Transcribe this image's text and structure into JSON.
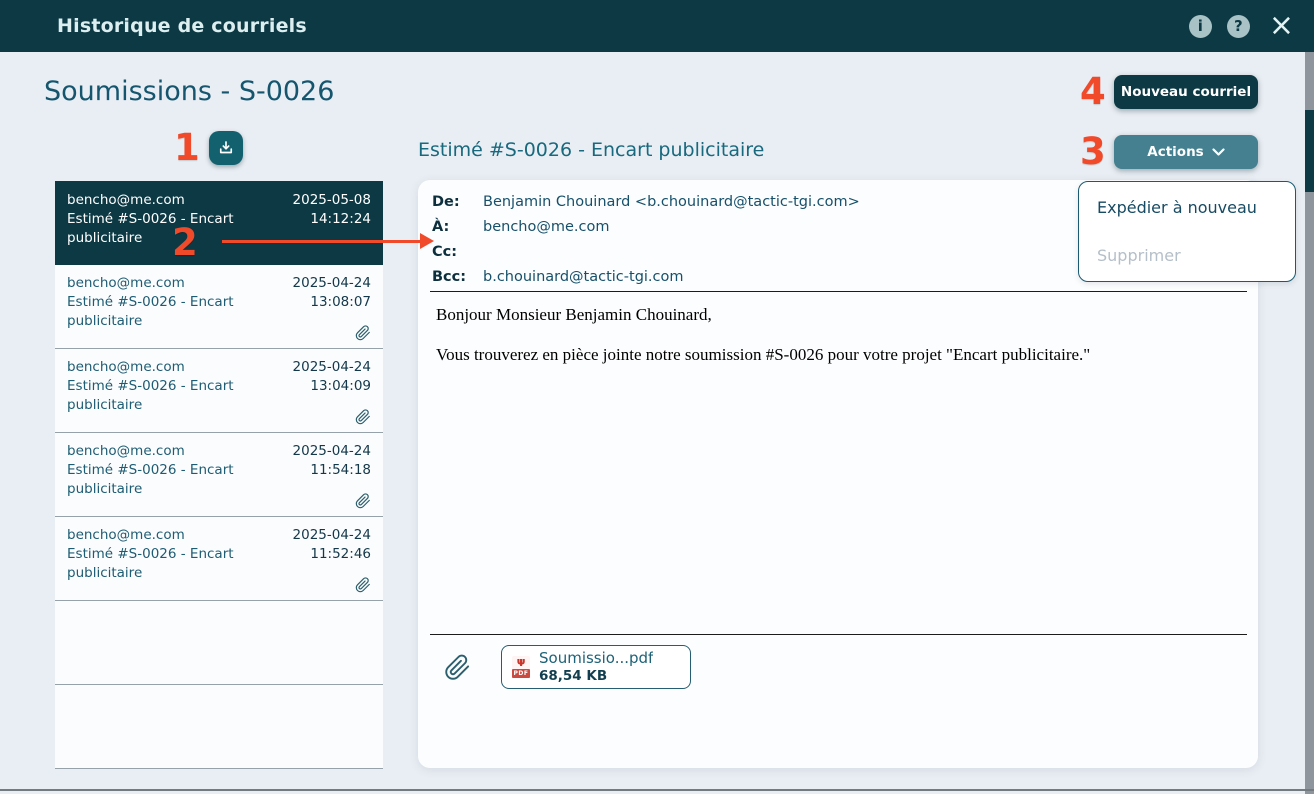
{
  "window": {
    "title": "Historique de courriels",
    "info_icon": "i",
    "help_icon": "?",
    "close_icon": "×"
  },
  "page": {
    "heading": "Soumissions - S-0026"
  },
  "toolbar": {
    "new_email_label": "Nouveau courriel",
    "actions_label": "Actions"
  },
  "actions_menu": {
    "items": [
      {
        "label": "Expédier à nouveau",
        "enabled": true
      },
      {
        "label": "Supprimer",
        "enabled": false
      }
    ]
  },
  "annotations": {
    "n1": "1",
    "n2": "2",
    "n3": "3",
    "n4": "4",
    "color": "#f04a2b"
  },
  "email_list": {
    "items": [
      {
        "from": "bencho@me.com",
        "subject": "Estimé #S-0026 - Encart publicitaire",
        "date": "2025-05-08",
        "time": "14:12:24",
        "selected": true,
        "attachment": false
      },
      {
        "from": "bencho@me.com",
        "subject": "Estimé #S-0026 - Encart publicitaire",
        "date": "2025-04-24",
        "time": "13:08:07",
        "selected": false,
        "attachment": true
      },
      {
        "from": "bencho@me.com",
        "subject": "Estimé #S-0026 - Encart publicitaire",
        "date": "2025-04-24",
        "time": "13:04:09",
        "selected": false,
        "attachment": true
      },
      {
        "from": "bencho@me.com",
        "subject": "Estimé #S-0026 - Encart publicitaire",
        "date": "2025-04-24",
        "time": "11:54:18",
        "selected": false,
        "attachment": true
      },
      {
        "from": "bencho@me.com",
        "subject": "Estimé #S-0026 - Encart publicitaire",
        "date": "2025-04-24",
        "time": "11:52:46",
        "selected": false,
        "attachment": true
      }
    ]
  },
  "email_view": {
    "subject": "Estimé #S-0026 - Encart publicitaire",
    "headers": [
      {
        "label": "De:",
        "value": "Benjamin Chouinard <b.chouinard@tactic-tgi.com>"
      },
      {
        "label": "À:",
        "value": "bencho@me.com"
      },
      {
        "label": "Cc:",
        "value": ""
      },
      {
        "label": "Bcc:",
        "value": "b.chouinard@tactic-tgi.com"
      }
    ],
    "body": [
      "Bonjour Monsieur Benjamin Chouinard,",
      "Vous trouverez en pièce jointe notre soumission #S-0026 pour votre projet \"Encart publicitaire.\""
    ],
    "attachment": {
      "filename": "Soumissio...pdf",
      "size": "68,54 KB",
      "type_label": "PDF"
    }
  },
  "colors": {
    "header_bar": "#0c3944",
    "page_background": "#e9eef4",
    "accent_teal": "#44808f",
    "annotation_red": "#f04a2b",
    "selected_item_bg": "#0c3944"
  }
}
